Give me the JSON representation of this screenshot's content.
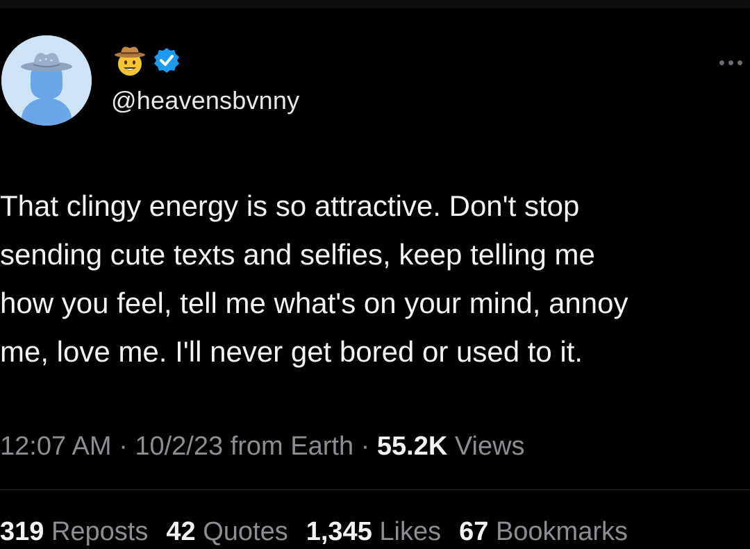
{
  "profile": {
    "handle": "@heavensbvnny",
    "display_emoji": "cowboy-hat-face-icon",
    "verified_icon": "verified-badge-icon",
    "avatar_icon": "default-avatar-with-cowboy-hat-icon",
    "verified_color": "#1d9bf0"
  },
  "tweet": {
    "lines": [
      "That clingy energy is so attractive. Don't stop",
      "sending cute texts and selfies, keep telling me",
      "how you feel, tell me what's on your mind, annoy",
      "me, love me. I'll never get bored or used to it."
    ]
  },
  "meta": {
    "time": "12:07 AM",
    "sep1": " · ",
    "date": "10/2/23",
    "source": " from Earth",
    "sep2": " · ",
    "views_count": "55.2K",
    "views_label": " Views"
  },
  "stats": {
    "reposts_count": "319",
    "reposts_label": " Reposts",
    "quotes_count": "42",
    "quotes_label": " Quotes",
    "likes_count": "1,345",
    "likes_label": " Likes",
    "bookmarks_count": "67",
    "bookmarks_label": " Bookmarks"
  },
  "menu": {
    "more_icon": "more-options-icon"
  }
}
